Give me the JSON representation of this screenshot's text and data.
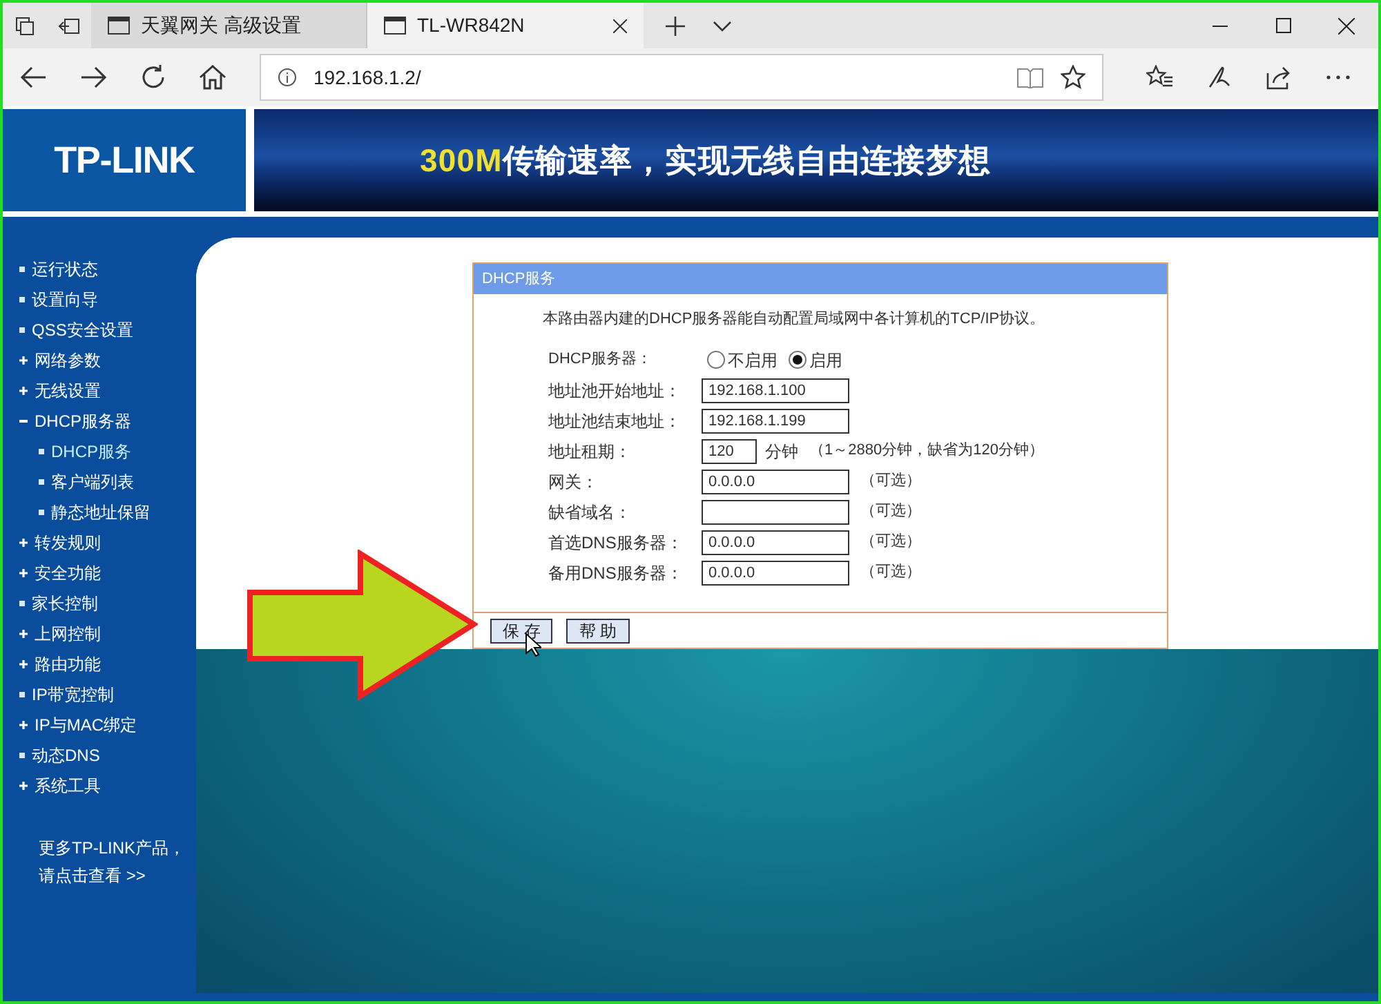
{
  "browser": {
    "tabs": [
      {
        "title": "天翼网关 高级设置",
        "selected": false
      },
      {
        "title": "TL-WR842N",
        "selected": true
      }
    ],
    "address": "192.168.1.2/"
  },
  "banner": {
    "logo": "TP-LINK",
    "slogan_highlight": "300M",
    "slogan": "传输速率，实现无线自由连接梦想"
  },
  "sidebar": {
    "items": [
      {
        "label": "运行状态",
        "kind": "page",
        "selected": false
      },
      {
        "label": "设置向导",
        "kind": "page",
        "selected": false
      },
      {
        "label": "QSS安全设置",
        "kind": "page",
        "selected": false
      },
      {
        "label": "网络参数",
        "kind": "group",
        "expanded": false,
        "selected": false
      },
      {
        "label": "无线设置",
        "kind": "group",
        "expanded": false,
        "selected": false
      },
      {
        "label": "DHCP服务器",
        "kind": "group",
        "expanded": true,
        "selected": false,
        "children": [
          {
            "label": "DHCP服务",
            "kind": "page",
            "selected": true
          },
          {
            "label": "客户端列表",
            "kind": "page",
            "selected": false
          },
          {
            "label": "静态地址保留",
            "kind": "page",
            "selected": false
          }
        ]
      },
      {
        "label": "转发规则",
        "kind": "group",
        "expanded": false,
        "selected": false
      },
      {
        "label": "安全功能",
        "kind": "group",
        "expanded": false,
        "selected": false
      },
      {
        "label": "家长控制",
        "kind": "page",
        "selected": false
      },
      {
        "label": "上网控制",
        "kind": "group",
        "expanded": false,
        "selected": false
      },
      {
        "label": "路由功能",
        "kind": "group",
        "expanded": false,
        "selected": false
      },
      {
        "label": "IP带宽控制",
        "kind": "page",
        "selected": false
      },
      {
        "label": "IP与MAC绑定",
        "kind": "group",
        "expanded": false,
        "selected": false
      },
      {
        "label": "动态DNS",
        "kind": "page",
        "selected": false
      },
      {
        "label": "系统工具",
        "kind": "group",
        "expanded": false,
        "selected": false
      }
    ],
    "more_link": [
      "更多TP-LINK产品，",
      "请点击查看 >>"
    ]
  },
  "panel": {
    "title": "DHCP服务",
    "description": "本路由器内建的DHCP服务器能自动配置局域网中各计算机的TCP/IP协议。",
    "server": {
      "label": "DHCP服务器：",
      "options": [
        {
          "label": "不启用",
          "selected": false
        },
        {
          "label": "启用",
          "selected": true
        }
      ]
    },
    "fields": [
      {
        "label": "地址池开始地址：",
        "value": "192.168.1.100"
      },
      {
        "label": "地址池结束地址：",
        "value": "192.168.1.199"
      },
      {
        "label": "地址租期：",
        "value": "120",
        "unit": "分钟",
        "note": "（1～2880分钟，缺省为120分钟）"
      },
      {
        "label": "网关：",
        "value": "0.0.0.0",
        "note": "（可选）"
      },
      {
        "label": "缺省域名：",
        "note": "（可选）"
      },
      {
        "label": "首选DNS服务器：",
        "value": "0.0.0.0",
        "note": "（可选）"
      },
      {
        "label": "备用DNS服务器：",
        "value": "0.0.0.0",
        "note": "（可选）"
      }
    ],
    "buttons": [
      "保 存",
      "帮 助"
    ]
  }
}
